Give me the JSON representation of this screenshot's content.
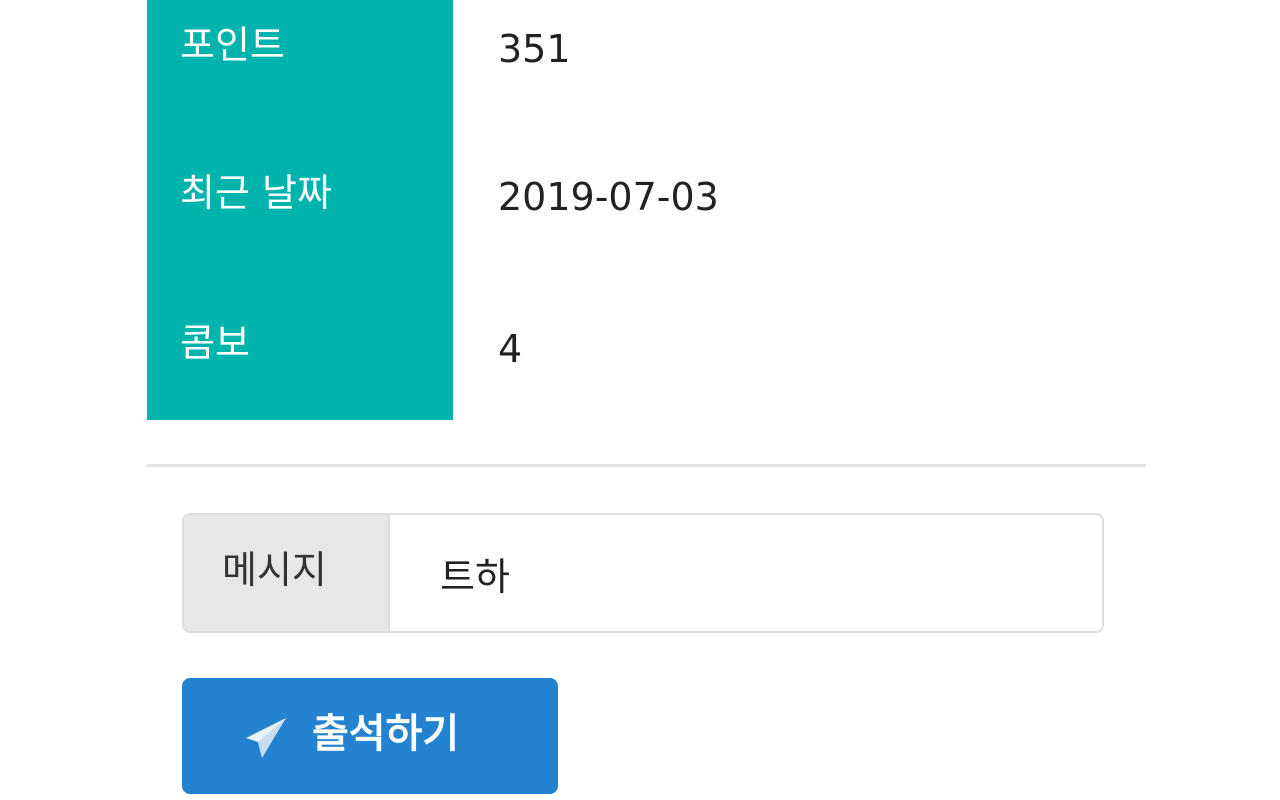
{
  "stats": {
    "points": {
      "label": "포인트",
      "value": "351"
    },
    "recent_date": {
      "label": "최근 날짜",
      "value": "2019-07-03"
    },
    "combo": {
      "label": "콤보",
      "value": "4"
    }
  },
  "message": {
    "addon_label": "메시지",
    "value": "트하"
  },
  "submit": {
    "label": "출석하기",
    "icon": "paper-plane-icon"
  },
  "colors": {
    "label_bg": "#00b3ad",
    "button_bg": "#2383d1"
  }
}
